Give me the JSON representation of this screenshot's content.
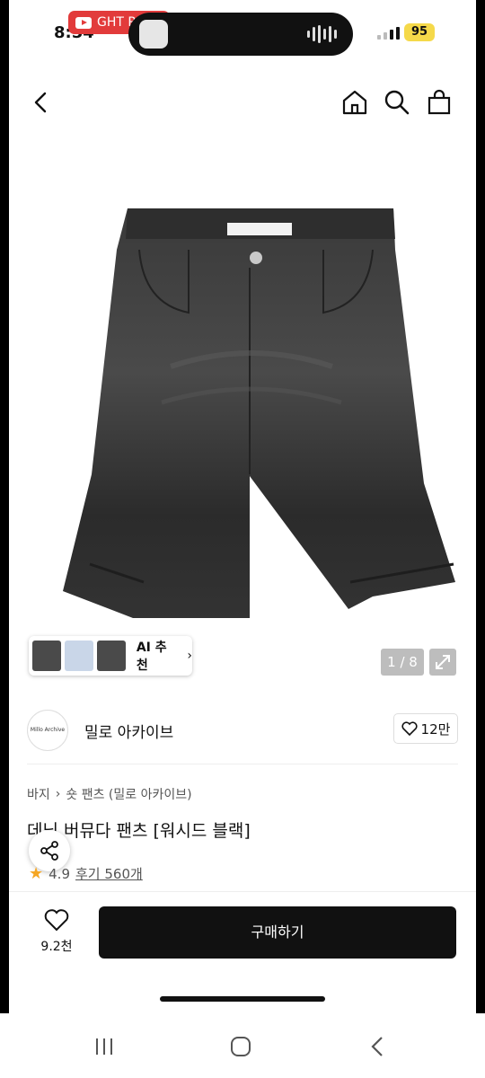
{
  "status": {
    "time": "8:54",
    "yt_pill": "GHT PASS",
    "battery": "95"
  },
  "header": {
    "back": "back",
    "icons": [
      "home-icon",
      "search-icon",
      "shopping-bag-icon"
    ]
  },
  "gallery": {
    "ai_label": "AI 추천",
    "counter": "1 / 8"
  },
  "brand": {
    "logo_text": "Millo Archive",
    "name": "밀로 아카이브",
    "likes": "12만"
  },
  "breadcrumb": {
    "items": [
      "바지",
      "숏 팬츠 (밀로 아카이브)"
    ]
  },
  "product": {
    "title": "데님 버뮤다 팬츠 [워시드 블랙]",
    "rating": "4.9",
    "reviews": "후기 560개"
  },
  "bottom": {
    "wish_count": "9.2천",
    "buy_label": "구매하기"
  },
  "colors": {
    "accent": "#111111",
    "star": "#f5a623",
    "yt": "#e23b3b"
  }
}
